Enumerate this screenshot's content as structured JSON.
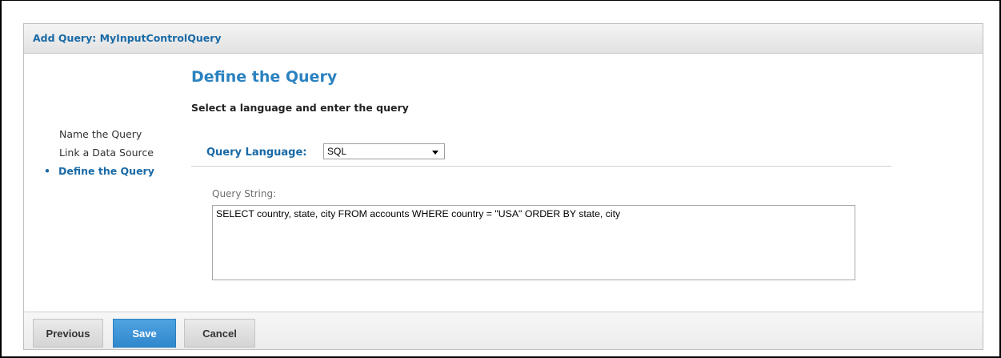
{
  "dialog": {
    "title": "Add Query: MyInputControlQuery"
  },
  "steps": [
    {
      "label": "Name the Query",
      "active": false
    },
    {
      "label": "Link a Data Source",
      "active": false
    },
    {
      "label": "Define the Query",
      "active": true,
      "bullet": "•"
    }
  ],
  "main": {
    "heading": "Define the Query",
    "subheading": "Select a language and enter the query",
    "query_language_label": "Query Language:",
    "query_language_value": "SQL",
    "query_string_label": "Query String:",
    "query_string_value": "SELECT country, state, city FROM accounts WHERE country = \"USA\" ORDER BY state, city"
  },
  "footer": {
    "previous_label": "Previous",
    "save_label": "Save",
    "cancel_label": "Cancel"
  },
  "colors": {
    "accent": "#2b82c0",
    "title_text": "#1a6aa6",
    "save_button": "#3a8fd4"
  }
}
